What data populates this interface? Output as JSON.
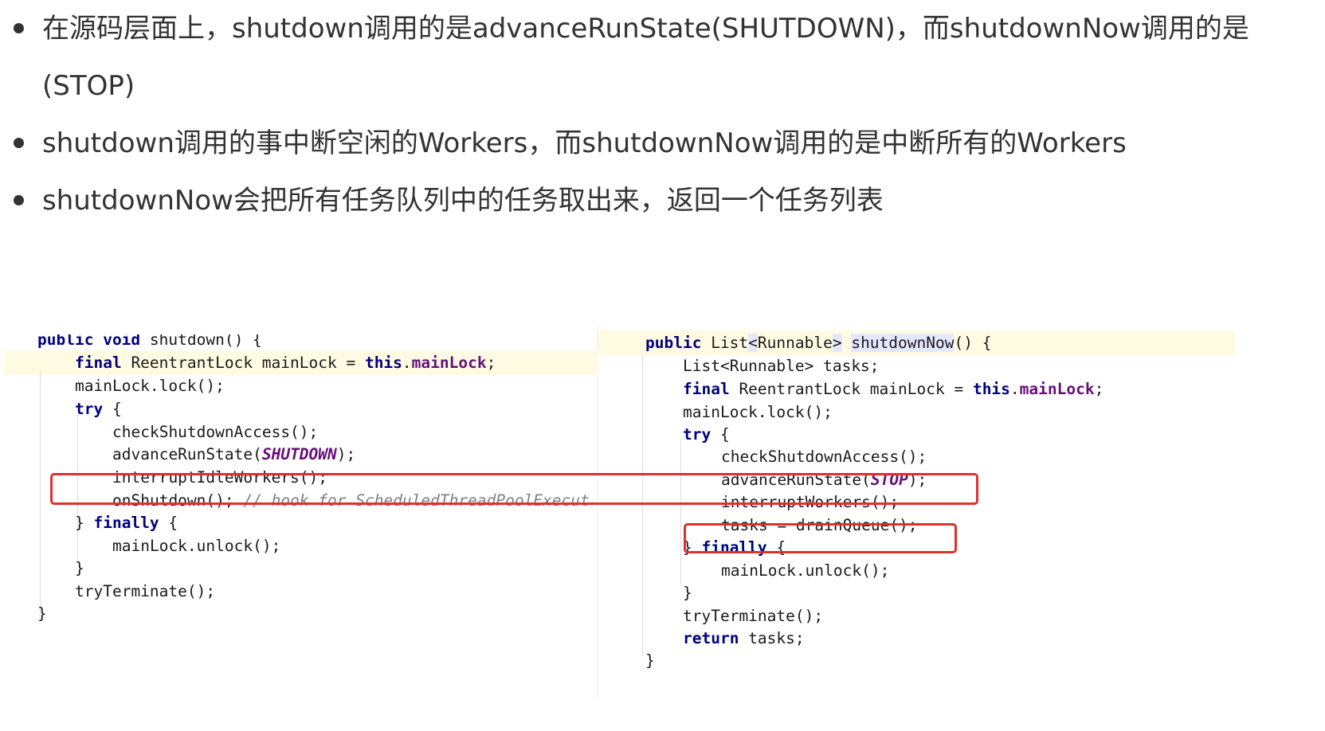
{
  "bullets": [
    "在源码层面上，shutdown调用的是advanceRunState(SHUTDOWN)，而shutdownNow调用的是(STOP)",
    "shutdown调用的事中断空闲的Workers，而shutdownNow调用的是中断所有的Workers",
    "shutdownNow会把所有任务队列中的任务取出来，返回一个任务列表"
  ],
  "colors": {
    "keyword": "#000080",
    "field": "#660e7a",
    "comment": "#808080",
    "highlight_box": "#e0302e",
    "current_line": "#fffbe3"
  },
  "left_code": {
    "l1": {
      "kw1": "public",
      "kw2": "void",
      "rest": " shutdown() {"
    },
    "l2": {
      "kw": "final",
      "mid": " ReentrantLock mainLock = ",
      "kw2": "this",
      "dot": ".",
      "fld": "mainLock",
      "end": ";"
    },
    "l3": "mainLock.lock();",
    "l4": {
      "kw": "try",
      "rest": " {"
    },
    "l5": "checkShutdownAccess();",
    "l6": {
      "pre": "advanceRunState(",
      "cst": "SHUTDOWN",
      "end": ");"
    },
    "l7": "interruptIdleWorkers();",
    "l8": {
      "pre": "onShutdown(); ",
      "cmt": "// hook for ScheduledThreadPoolExecut"
    },
    "l9": {
      "pre": "} ",
      "kw": "finally",
      "rest": " {"
    },
    "l10": "mainLock.unlock();",
    "l11": "}",
    "l12": "tryTerminate();",
    "l13": "}"
  },
  "right_code": {
    "l1": {
      "kw": "public",
      "pre": " List",
      "lt": "<",
      "type": "Runnable",
      "gt": ">",
      "sp": " ",
      "name": "shutdownNow",
      "rest": "() {"
    },
    "l2": "List<Runnable> tasks;",
    "l3": {
      "kw": "final",
      "mid": " ReentrantLock mainLock = ",
      "kw2": "this",
      "dot": ".",
      "fld": "mainLock",
      "end": ";"
    },
    "l4": "mainLock.lock();",
    "l5": {
      "kw": "try",
      "rest": " {"
    },
    "l6": "checkShutdownAccess();",
    "l7": {
      "pre": "advanceRunState(",
      "cst": "STOP",
      "end": ");"
    },
    "l8": "interruptWorkers();",
    "l9": "tasks = drainQueue();",
    "l10": {
      "pre": "} ",
      "kw": "finally",
      "rest": " {"
    },
    "l11": "mainLock.unlock();",
    "l12": "}",
    "l13": "tryTerminate();",
    "l14": {
      "kw": "return",
      "rest": " tasks;"
    },
    "l15": "}"
  }
}
